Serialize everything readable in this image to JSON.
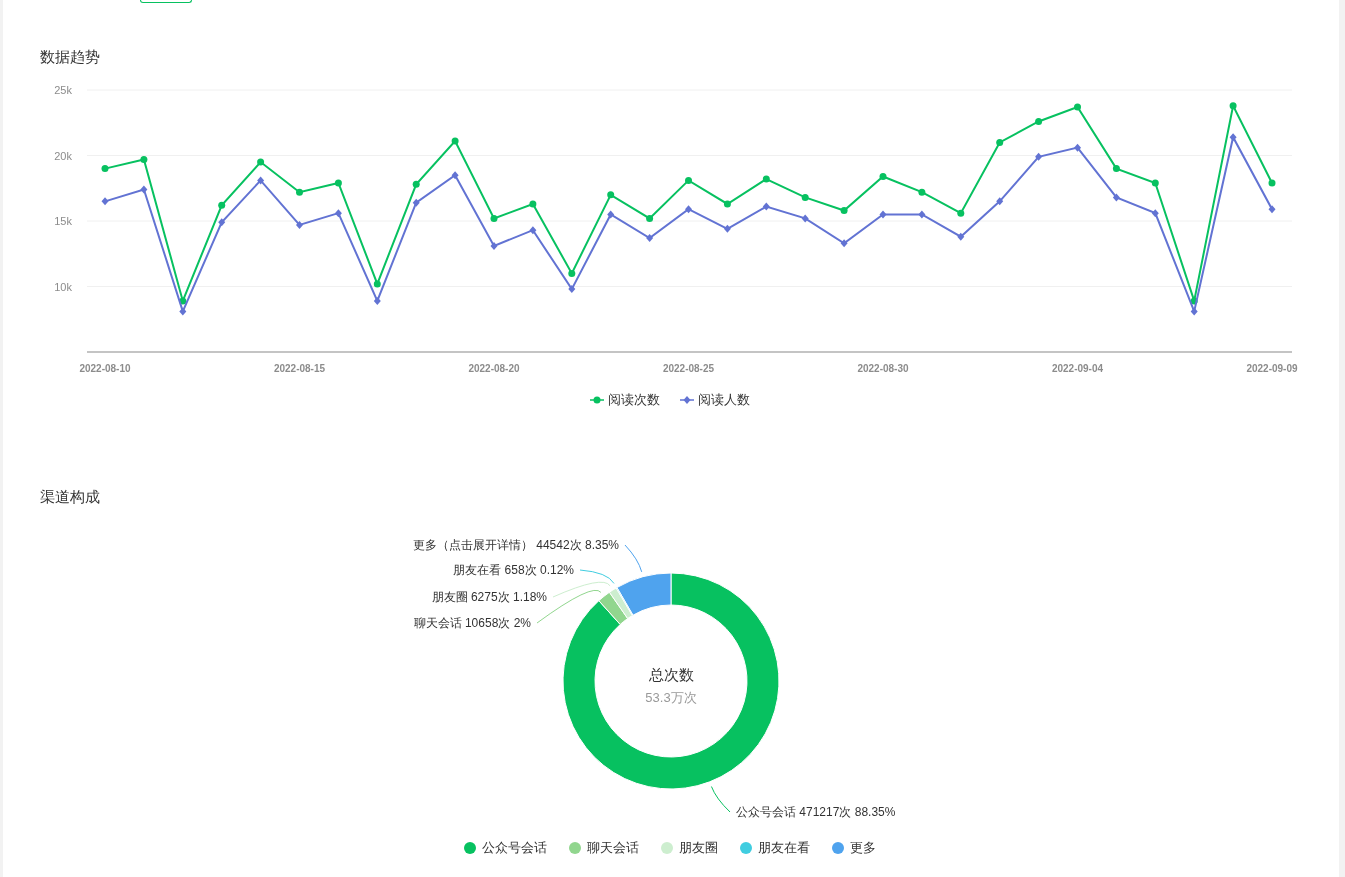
{
  "trend": {
    "title": "数据趋势",
    "chart_data": {
      "type": "line",
      "grid": true,
      "categories": [
        "2022-08-10",
        null,
        null,
        null,
        null,
        "2022-08-15",
        null,
        null,
        null,
        null,
        "2022-08-20",
        null,
        null,
        null,
        null,
        "2022-08-25",
        null,
        null,
        null,
        null,
        "2022-08-30",
        null,
        null,
        null,
        null,
        "2022-09-04",
        null,
        null,
        null,
        null,
        "2022-09-09"
      ],
      "ylim": [
        5000,
        25000
      ],
      "yticks": [
        {
          "value": 10000,
          "label": "10k"
        },
        {
          "value": 15000,
          "label": "15k"
        },
        {
          "value": 20000,
          "label": "20k"
        },
        {
          "value": 25000,
          "label": "25k"
        }
      ],
      "series": [
        {
          "name": "阅读次数",
          "color": "#07c160",
          "marker": "circle",
          "values": [
            19000,
            19700,
            8900,
            16200,
            19500,
            17200,
            17900,
            10200,
            17800,
            21100,
            15200,
            16300,
            11000,
            17000,
            15200,
            18100,
            16300,
            18200,
            16800,
            15800,
            18400,
            17200,
            15600,
            21000,
            22600,
            23700,
            19000,
            17900,
            8900,
            23800,
            17900
          ]
        },
        {
          "name": "阅读人数",
          "color": "#6273d3",
          "marker": "diamond",
          "values": [
            16500,
            17400,
            8100,
            14900,
            18100,
            14700,
            15600,
            8900,
            16400,
            18500,
            13100,
            14300,
            9800,
            15500,
            13700,
            15900,
            14400,
            16100,
            15200,
            13300,
            15500,
            15500,
            13800,
            16500,
            19900,
            20600,
            16800,
            15600,
            8100,
            21400,
            15900
          ]
        }
      ]
    }
  },
  "channels": {
    "title": "渠道构成",
    "center_title": "总次数",
    "center_value": "53.3万次",
    "chart_data": {
      "type": "donut",
      "categories": [
        "公众号会话",
        "聊天会话",
        "朋友圈",
        "朋友在看",
        "更多"
      ],
      "values": [
        471217,
        10658,
        6275,
        658,
        44542
      ],
      "colors": [
        "#07c160",
        "#91d68e",
        "#cdeecf",
        "#40cde0",
        "#4fa3ee"
      ],
      "value_labels": [
        "公众号会话 471217次 88.35%",
        "聊天会话 10658次 2%",
        "朋友圈 6275次 1.18%",
        "朋友在看 658次 0.12%",
        "更多（点击展开详情） 44542次 8.35%"
      ]
    }
  }
}
